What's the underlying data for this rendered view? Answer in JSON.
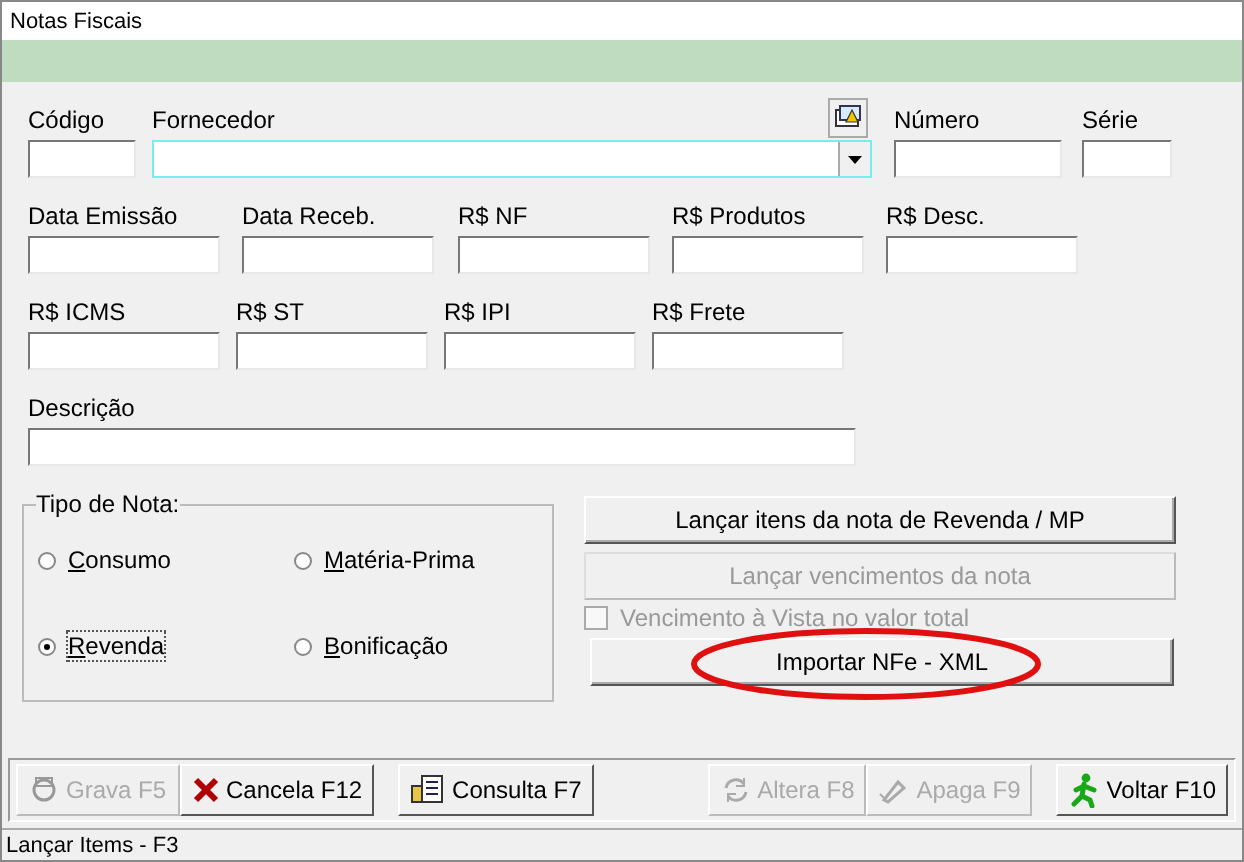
{
  "window": {
    "title": "Notas Fiscais"
  },
  "field_rows": [
    [
      {
        "label": "Código",
        "kind": "text"
      },
      {
        "label": "Fornecedor",
        "kind": "combo"
      },
      {
        "label": "Número",
        "kind": "text"
      },
      {
        "label": "Série",
        "kind": "text"
      }
    ],
    [
      {
        "label": "Data Emissão",
        "kind": "text"
      },
      {
        "label": "Data Receb.",
        "kind": "text"
      },
      {
        "label": "R$ NF",
        "kind": "text"
      },
      {
        "label": "R$ Produtos",
        "kind": "text"
      },
      {
        "label": "R$ Desc.",
        "kind": "text"
      }
    ],
    [
      {
        "label": "R$ ICMS",
        "kind": "text"
      },
      {
        "label": "R$ ST",
        "kind": "text"
      },
      {
        "label": "R$ IPI",
        "kind": "text"
      },
      {
        "label": "R$ Frete",
        "kind": "text"
      }
    ],
    [
      {
        "label": "Descrição",
        "kind": "text"
      }
    ]
  ],
  "tipo_nota": {
    "title": "Tipo de Nota:",
    "options": [
      {
        "label": "Consumo",
        "selected": false
      },
      {
        "label": "Matéria-Prima",
        "selected": false
      },
      {
        "label": "Revenda",
        "selected": true
      },
      {
        "label": "Bonificação",
        "selected": false
      }
    ]
  },
  "actions": {
    "launch_items": {
      "label": "Lançar itens da nota de Revenda / MP",
      "disabled": false
    },
    "launch_due": {
      "label": "Lançar vencimentos da nota",
      "disabled": true
    },
    "cash_due": {
      "label": "Vencimento à Vista no valor total",
      "checked": false,
      "disabled": true
    },
    "import_xml": {
      "label": "Importar NFe - XML",
      "disabled": false
    }
  },
  "toolbar": [
    {
      "label": "Grava F5",
      "kind": "save",
      "disabled": true
    },
    {
      "label": "Cancela F12",
      "kind": "cancel",
      "disabled": false
    },
    {
      "label": "Consulta F7",
      "kind": "query",
      "disabled": false
    },
    {
      "label": "Altera F8",
      "kind": "edit",
      "disabled": true
    },
    {
      "label": "Apaga F9",
      "kind": "delete",
      "disabled": true
    },
    {
      "label": "Voltar F10",
      "kind": "back",
      "disabled": false
    }
  ],
  "status_bar": "Lançar Items - F3"
}
